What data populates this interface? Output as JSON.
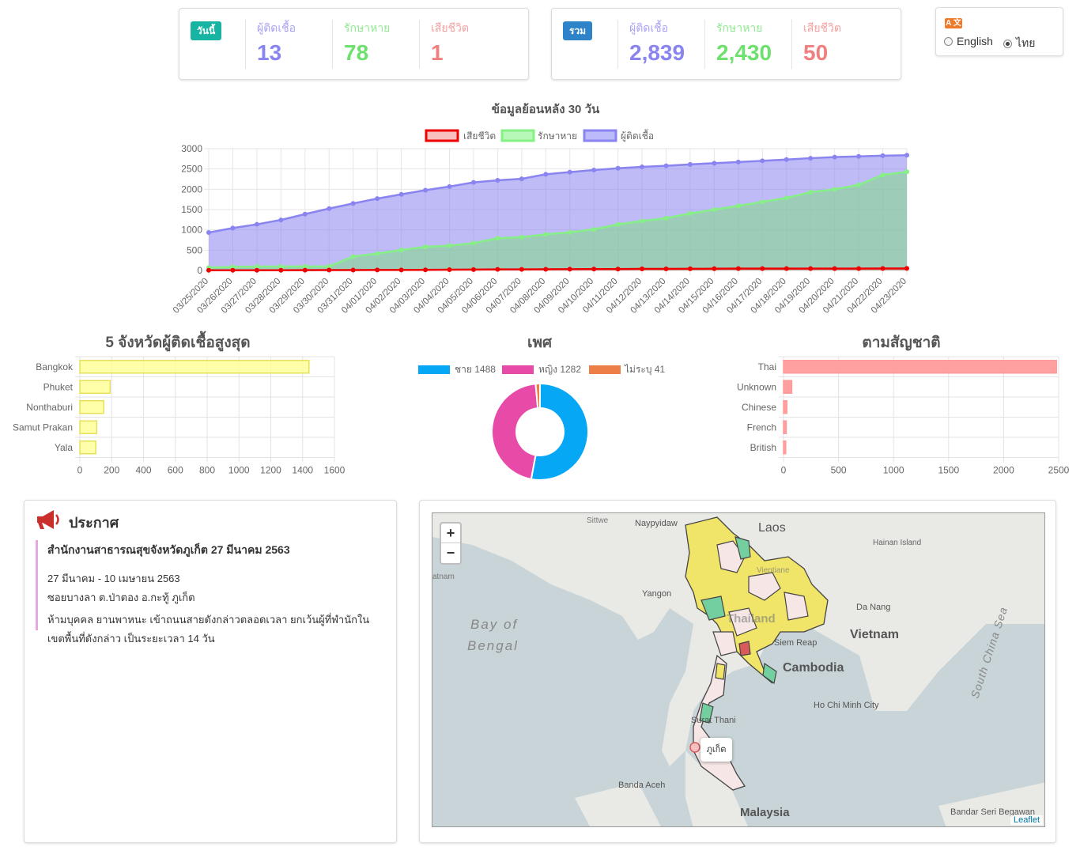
{
  "today": {
    "badge": "วันนี้",
    "infected_label": "ผู้ติดเชื้อ",
    "infected": "13",
    "recovered_label": "รักษาหาย",
    "recovered": "78",
    "deaths_label": "เสียชีวิต",
    "deaths": "1"
  },
  "total": {
    "badge": "รวม",
    "infected_label": "ผู้ติดเชื้อ",
    "infected": "2,839",
    "recovered_label": "รักษาหาย",
    "recovered": "2,430",
    "deaths_label": "เสียชีวิต",
    "deaths": "50"
  },
  "language": {
    "icon": "translate-icon",
    "icon_text": "A 文",
    "options": [
      "English",
      "ไทย"
    ],
    "selected": "ไทย"
  },
  "colors": {
    "infected": "#8a84f0",
    "recovered": "#7be07b",
    "deaths": "#f08080",
    "teal": "#17b3a3",
    "blue": "#2f84c9"
  },
  "chart_data": [
    {
      "type": "area",
      "title": "ข้อมูลย้อนหลัง 30 วัน",
      "legend": [
        "เสียชีวิต",
        "รักษาหาย",
        "ผู้ติดเชื้อ"
      ],
      "legend_position": "top",
      "ylim": [
        0,
        3000
      ],
      "yticks": [
        0,
        500,
        1000,
        1500,
        2000,
        2500,
        3000
      ],
      "x": [
        "03/25/2020",
        "03/26/2020",
        "03/27/2020",
        "03/28/2020",
        "03/29/2020",
        "03/30/2020",
        "03/31/2020",
        "04/01/2020",
        "04/02/2020",
        "04/03/2020",
        "04/04/2020",
        "04/05/2020",
        "04/06/2020",
        "04/07/2020",
        "04/08/2020",
        "04/09/2020",
        "04/10/2020",
        "04/11/2020",
        "04/12/2020",
        "04/13/2020",
        "04/14/2020",
        "04/15/2020",
        "04/16/2020",
        "04/17/2020",
        "04/18/2020",
        "04/19/2020",
        "04/20/2020",
        "04/21/2020",
        "04/22/2020",
        "04/23/2020"
      ],
      "series": [
        {
          "name": "ผู้ติดเชื้อ",
          "values": [
            934,
            1045,
            1136,
            1245,
            1388,
            1524,
            1651,
            1771,
            1875,
            1978,
            2067,
            2169,
            2220,
            2258,
            2369,
            2423,
            2473,
            2518,
            2551,
            2579,
            2613,
            2643,
            2672,
            2700,
            2733,
            2765,
            2792,
            2811,
            2826,
            2839
          ]
        },
        {
          "name": "รักษาหาย",
          "values": [
            70,
            88,
            97,
            97,
            100,
            100,
            342,
            416,
            505,
            581,
            612,
            674,
            793,
            821,
            888,
            940,
            1013,
            1135,
            1218,
            1288,
            1405,
            1497,
            1593,
            1689,
            1787,
            1928,
            1999,
            2108,
            2352,
            2430
          ]
        },
        {
          "name": "เสียชีวิต",
          "values": [
            4,
            4,
            5,
            6,
            7,
            9,
            10,
            12,
            12,
            15,
            19,
            23,
            26,
            27,
            30,
            32,
            33,
            35,
            38,
            40,
            41,
            43,
            46,
            46,
            47,
            47,
            47,
            47,
            49,
            50
          ]
        }
      ]
    },
    {
      "type": "bar",
      "title": "5 จังหวัดผู้ติดเชื้อสูงสุด",
      "categories": [
        "Bangkok",
        "Phuket",
        "Nonthaburi",
        "Samut Prakan",
        "Yala"
      ],
      "values": [
        1440,
        190,
        150,
        106,
        100
      ],
      "xlim": [
        0,
        1600
      ],
      "xticks": [
        0,
        200,
        400,
        600,
        800,
        1000,
        1200,
        1400,
        1600
      ]
    },
    {
      "type": "pie",
      "title": "เพศ",
      "legend": [
        "ชาย 1488",
        "หญิง 1282",
        "ไม่ระบุ 41"
      ],
      "legend_position": "top",
      "labels": [
        "ชาย",
        "หญิง",
        "ไม่ระบุ"
      ],
      "values": [
        1488,
        1282,
        41
      ],
      "colors": [
        "#06a7f5",
        "#e84aa8",
        "#ee7e48"
      ]
    },
    {
      "type": "bar",
      "title": "ตามสัญชาติ",
      "categories": [
        "Thai",
        "Unknown",
        "Chinese",
        "French",
        "British"
      ],
      "values": [
        2480,
        75,
        30,
        25,
        20
      ],
      "xlim": [
        0,
        2500
      ],
      "xticks": [
        0,
        500,
        1000,
        1500,
        2000,
        2500
      ]
    }
  ],
  "announcement": {
    "title": "ประกาศ",
    "icon": "megaphone-icon",
    "headline": "สำนักงานสาธารณสุขจังหวัดภูเก็ต 27 มีนาคม 2563",
    "date_range": "27 มีนาคม - 10 เมษายน 2563",
    "location": "ซอยบางลา ต.ป่าตอง อ.กะทู้ ภูเก็ต",
    "body_line1": "ห้ามบุคคล ยานพาหนะ เข้าถนนสายดังกล่าวตลอดเวลา ยกเว้นผู้ที่พำนักใน",
    "body_line2": "เขตพื้นที่ดังกล่าว เป็นระยะเวลา 14 วัน"
  },
  "map": {
    "zoom_in": "+",
    "zoom_out": "−",
    "attribution": "Leaflet",
    "popup": "ภูเก็ต",
    "labels": {
      "laos": "Laos",
      "vietnam": "Vietnam",
      "cambodia": "Cambodia",
      "malaysia": "Malaysia",
      "bay": "Bay of",
      "bengal": "Bengal",
      "scs": "South China Sea",
      "thailand": "Thailand",
      "naypyidaw": "Naypyidaw",
      "yangon": "Yangon",
      "hainan": "Hainan Island",
      "danang": "Da Nang",
      "siemreap": "Siem Reap",
      "hcmc": "Ho Chi Minh City",
      "surat": "Surat Thani",
      "banda": "Banda Aceh",
      "bandar": "Bandar Seri Begawan",
      "sittwe": "Sittwe",
      "natnam": "atnam",
      "vientiane": "Vientiane"
    }
  }
}
